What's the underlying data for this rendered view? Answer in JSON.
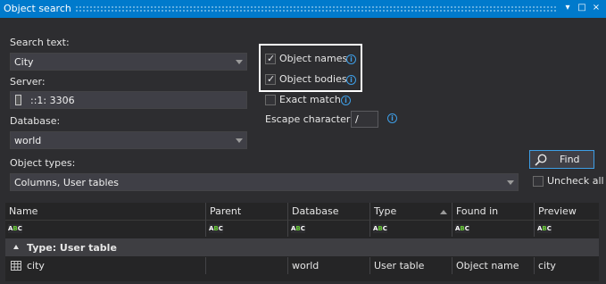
{
  "window": {
    "title": "Object search",
    "controls": [
      "▾",
      "□",
      "×"
    ]
  },
  "search": {
    "label": "Search text:",
    "value": "City"
  },
  "server": {
    "label": "Server:",
    "value": "::1: 3306"
  },
  "database": {
    "label": "Database:",
    "value": "world"
  },
  "object_types": {
    "label": "Object types:",
    "value": "Columns, User tables"
  },
  "options": {
    "object_names": {
      "label": "Object names",
      "checked": true
    },
    "object_bodies": {
      "label": "Object bodies",
      "checked": true
    },
    "exact_match": {
      "label": "Exact match",
      "checked": false
    },
    "escape_char": {
      "label": "Escape character:",
      "value": "/"
    }
  },
  "find_button": {
    "label": "Find"
  },
  "uncheck_all": {
    "label": "Uncheck all",
    "checked": false
  },
  "grid": {
    "columns": [
      "Name",
      "Parent",
      "Database",
      "Type",
      "Found in",
      "Preview"
    ],
    "filter_badge": {
      "a": "A",
      "b": "B",
      "c": "C"
    },
    "group_label": "Type: User table",
    "rows": [
      {
        "name": "city",
        "parent": "",
        "database": "world",
        "type": "User table",
        "found_in": "Object name",
        "preview": "city"
      }
    ]
  },
  "colors": {
    "accent": "#007acc",
    "background": "#2d2d30",
    "info": "#3e9ee6"
  }
}
